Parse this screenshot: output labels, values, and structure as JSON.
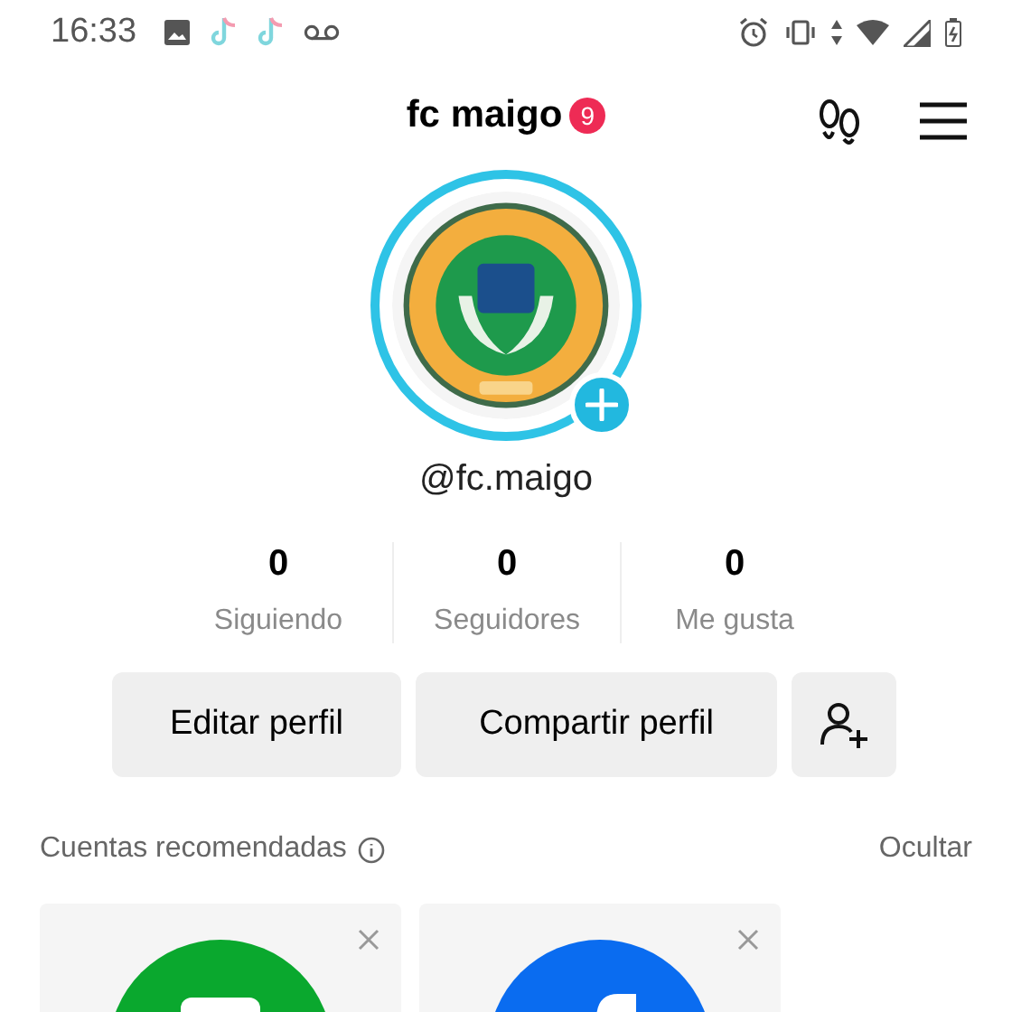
{
  "status_bar": {
    "time": "16:33"
  },
  "header": {
    "title": "fc maigo",
    "badge": "9"
  },
  "profile": {
    "handle": "@fc.maigo"
  },
  "stats": [
    {
      "value": "0",
      "label": "Siguiendo"
    },
    {
      "value": "0",
      "label": "Seguidores"
    },
    {
      "value": "0",
      "label": "Me gusta"
    }
  ],
  "buttons": [
    "Editar perfil",
    "Compartir perfil"
  ],
  "recommended": {
    "title": "Cuentas recomendadas",
    "hide": "Ocultar",
    "cards": [
      {
        "color": "#0aa82e",
        "kind": "message"
      },
      {
        "color": "#0a6cf0",
        "kind": "social"
      }
    ]
  }
}
